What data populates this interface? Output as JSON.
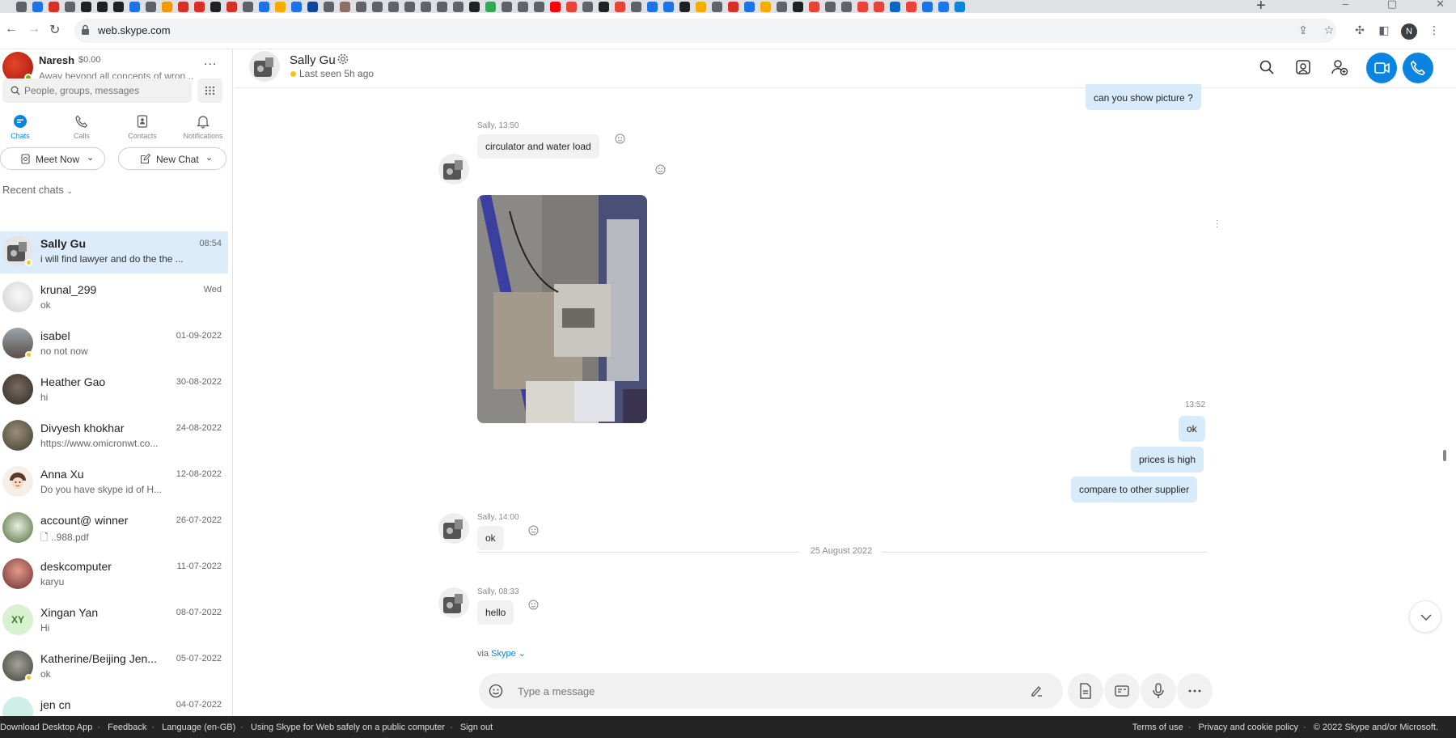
{
  "browser": {
    "url": "web.skype.com",
    "profile_initial": "N",
    "new_tab": "+",
    "favicon_colors": [
      "#5f6368",
      "#1a73e8",
      "#d93025",
      "#5f6368",
      "#202124",
      "#202124",
      "#202124",
      "#1a73e8",
      "#5f6368",
      "#f29900",
      "#d93025",
      "#d93025",
      "#202124",
      "#d93025",
      "#5f6368",
      "#1a73e8",
      "#f9ab00",
      "#1a73e8",
      "#0d47a1",
      "#5f6368",
      "#8d6e63",
      "#5f6368",
      "#5f6368",
      "#5f6368",
      "#5f6368",
      "#5f6368",
      "#5f6368",
      "#5f6368",
      "#202124",
      "#34a853",
      "#5f6368",
      "#5f6368",
      "#5f6368",
      "#ff0000",
      "#ea4335",
      "#5f6368",
      "#202124",
      "#ea4335",
      "#5f6368",
      "#1a73e8",
      "#1a73e8",
      "#202124",
      "#f9ab00",
      "#5f6368",
      "#d93025",
      "#1a73e8",
      "#f9ab00",
      "#5f6368",
      "#202124",
      "#ea4335",
      "#5f6368",
      "#5f6368",
      "#ea4335",
      "#ea4335",
      "#0a66c2",
      "#ea4335",
      "#1a73e8",
      "#1877f2",
      "#0a84e0"
    ]
  },
  "profile": {
    "name": "Naresh",
    "credit": "$0.00",
    "mood": "Away beyond all concepts of wron...",
    "more": "..."
  },
  "search": {
    "placeholder": "People, groups, messages"
  },
  "nav": {
    "tabs": [
      {
        "label": "Chats",
        "active": true
      },
      {
        "label": "Calls"
      },
      {
        "label": "Contacts"
      },
      {
        "label": "Notifications"
      }
    ]
  },
  "actions": {
    "meet_now": "Meet Now",
    "new_chat": "New Chat"
  },
  "recent_label": "Recent chats",
  "chats": [
    {
      "name": "Sally Gu",
      "date": "08:54",
      "preview": "i will find lawyer and do the the ..."
    },
    {
      "name": "krunal_299",
      "date": "Wed",
      "preview": "ok"
    },
    {
      "name": "isabel",
      "date": "01-09-2022",
      "preview": "no not now"
    },
    {
      "name": "Heather Gao",
      "date": "30-08-2022",
      "preview": "hi"
    },
    {
      "name": "Divyesh khokhar",
      "date": "24-08-2022",
      "preview": "https://www.omicronwt.co..."
    },
    {
      "name": "Anna Xu",
      "date": "12-08-2022",
      "preview": "Do you have skype id of H..."
    },
    {
      "name": "account@ winner",
      "date": "26-07-2022",
      "preview": "..988.pdf"
    },
    {
      "name": "deskcomputer",
      "date": "11-07-2022",
      "preview": "karyu"
    },
    {
      "name": "Xingan  Yan",
      "date": "08-07-2022",
      "preview": "Hi",
      "initials": "XY"
    },
    {
      "name": "Katherine/Beijing Jen...",
      "date": "05-07-2022",
      "preview": "ok"
    },
    {
      "name": "jen cn",
      "date": "04-07-2022",
      "preview": ""
    }
  ],
  "conversation": {
    "contact_name": "Sally Gu",
    "status": "Last seen 5h ago",
    "messages": {
      "out_top": "can you show picture ?",
      "in1_sender": "Sally, 13:50",
      "in1_text": "circulator and water load",
      "out_time": "13:52",
      "out1": "ok",
      "out2": "prices is high",
      "out3": "compare to other supplier",
      "in2_sender": "Sally, 14:00",
      "in2_text": "ok",
      "date_separator": "25 August 2022",
      "in3_sender": "Sally, 08:33",
      "in3_text": "hello",
      "via_prefix": "via",
      "via_link": "Skype"
    },
    "composer_placeholder": "Type a message"
  },
  "footer": {
    "left": [
      "Download Desktop App",
      "Feedback",
      "Language (en-GB)",
      "Using Skype for Web safely on a public computer",
      "Sign out"
    ],
    "right": [
      "Terms of use",
      "Privacy and cookie policy",
      "© 2022 Skype and/or Microsoft."
    ]
  }
}
